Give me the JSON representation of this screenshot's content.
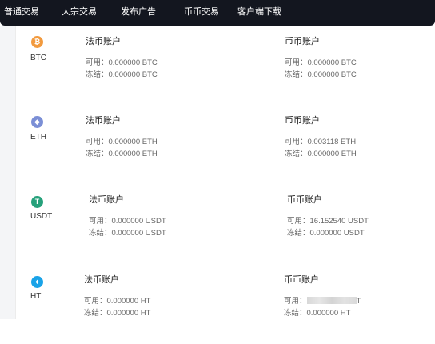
{
  "nav": {
    "items": [
      "普通交易",
      "大宗交易",
      "发布广告",
      "币币交易",
      "客户端下载"
    ]
  },
  "colors": {
    "nav_bg": "#13161f",
    "btc": "#f29a3e",
    "eth": "#7b8fd6",
    "usdt": "#26a17b",
    "ht": "#1aa3e8"
  },
  "assets": [
    {
      "coin": "BTC",
      "icon": "btc-icon",
      "glyph": "₿",
      "fiat": {
        "title": "法币账户",
        "available": "可用：0.000000 BTC",
        "frozen": "冻结：0.000000 BTC"
      },
      "spot": {
        "title": "币币账户",
        "available": "可用：0.000000 BTC",
        "frozen": "冻结：0.000000 BTC"
      }
    },
    {
      "coin": "ETH",
      "icon": "eth-icon",
      "glyph": "◆",
      "fiat": {
        "title": "法币账户",
        "available": "可用：0.000000 ETH",
        "frozen": "冻结：0.000000 ETH"
      },
      "spot": {
        "title": "币币账户",
        "available": "可用：0.003118 ETH",
        "frozen": "冻结：0.000000 ETH"
      }
    },
    {
      "coin": "USDT",
      "icon": "usdt-icon",
      "glyph": "T",
      "fiat": {
        "title": "法币账户",
        "available": "可用：0.000000 USDT",
        "frozen": "冻结：0.000000 USDT"
      },
      "spot": {
        "title": "币币账户",
        "available": "可用：16.152540 USDT",
        "frozen": "冻结：0.000000 USDT"
      }
    },
    {
      "coin": "HT",
      "icon": "ht-icon",
      "glyph": "♦",
      "fiat": {
        "title": "法币账户",
        "available": "可用：0.000000 HT",
        "frozen": "冻结：0.000000 HT"
      },
      "spot": {
        "title": "币币账户",
        "available_prefix": "可用：",
        "available_suffix": "T",
        "frozen": "冻结：0.000000 HT"
      }
    }
  ]
}
